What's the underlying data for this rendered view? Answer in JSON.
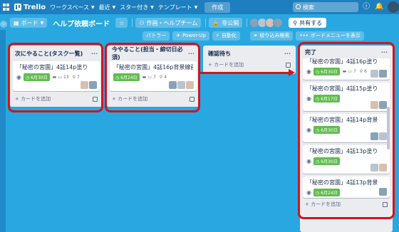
{
  "topbar": {
    "logo": "Trello",
    "menus": [
      "ワークスペース",
      "最近",
      "スター付き",
      "テンプレート"
    ],
    "create": "作成",
    "search_placeholder": "検索"
  },
  "board_header": {
    "view": "ボード",
    "title": "ヘルプ依頼ボード",
    "workspace": "作画・ヘルプチーム",
    "visibility": "非公開",
    "share": "共有する"
  },
  "sub_bar": {
    "butler": "バトラー",
    "powerup": "Power-Up",
    "automation": "自動化",
    "filter": "絞り込み検索",
    "board_menu": "ボードメニューを表示"
  },
  "lists": [
    {
      "title": "次にやること(タスク一覧)",
      "cards": [
        {
          "title": "「秘密の宮園」4話14p塗り",
          "due": "6月30日",
          "comments": "13",
          "attachments": "7"
        }
      ],
      "add": "+ カードを追加"
    },
    {
      "title": "今やること(担当・締切日必須)",
      "cards": [
        {
          "title": "「秘密の宮園」4話16p背景線画",
          "due": "6月24日",
          "comments": "7",
          "attachments": "4"
        }
      ],
      "add": "+ カードを追加"
    },
    {
      "title": "確認待ち",
      "add": "+ カードを追加"
    },
    {
      "title": "完了",
      "cards": [
        {
          "title": "「秘密の宮園」4話16p塗り",
          "due": "6月30日",
          "comments": "7",
          "attachments": "6"
        },
        {
          "title": "「秘密の宮園」4話15p塗り",
          "due": "6月17日"
        },
        {
          "title": "「秘密の宮園」4話14p背景",
          "due": "6月30日"
        },
        {
          "title": "「秘密の宮園」4話13p塗り",
          "due": "6月30日"
        },
        {
          "title": "「秘密の宮園」4話13p背景",
          "due": "6月24日"
        }
      ],
      "add": "+ カードを追加"
    }
  ],
  "colors": {
    "board_bg": "#29a7e0",
    "topbar": "#1d7fbf",
    "due_green": "#61bd4f",
    "annotation_red": "#d0161b"
  }
}
